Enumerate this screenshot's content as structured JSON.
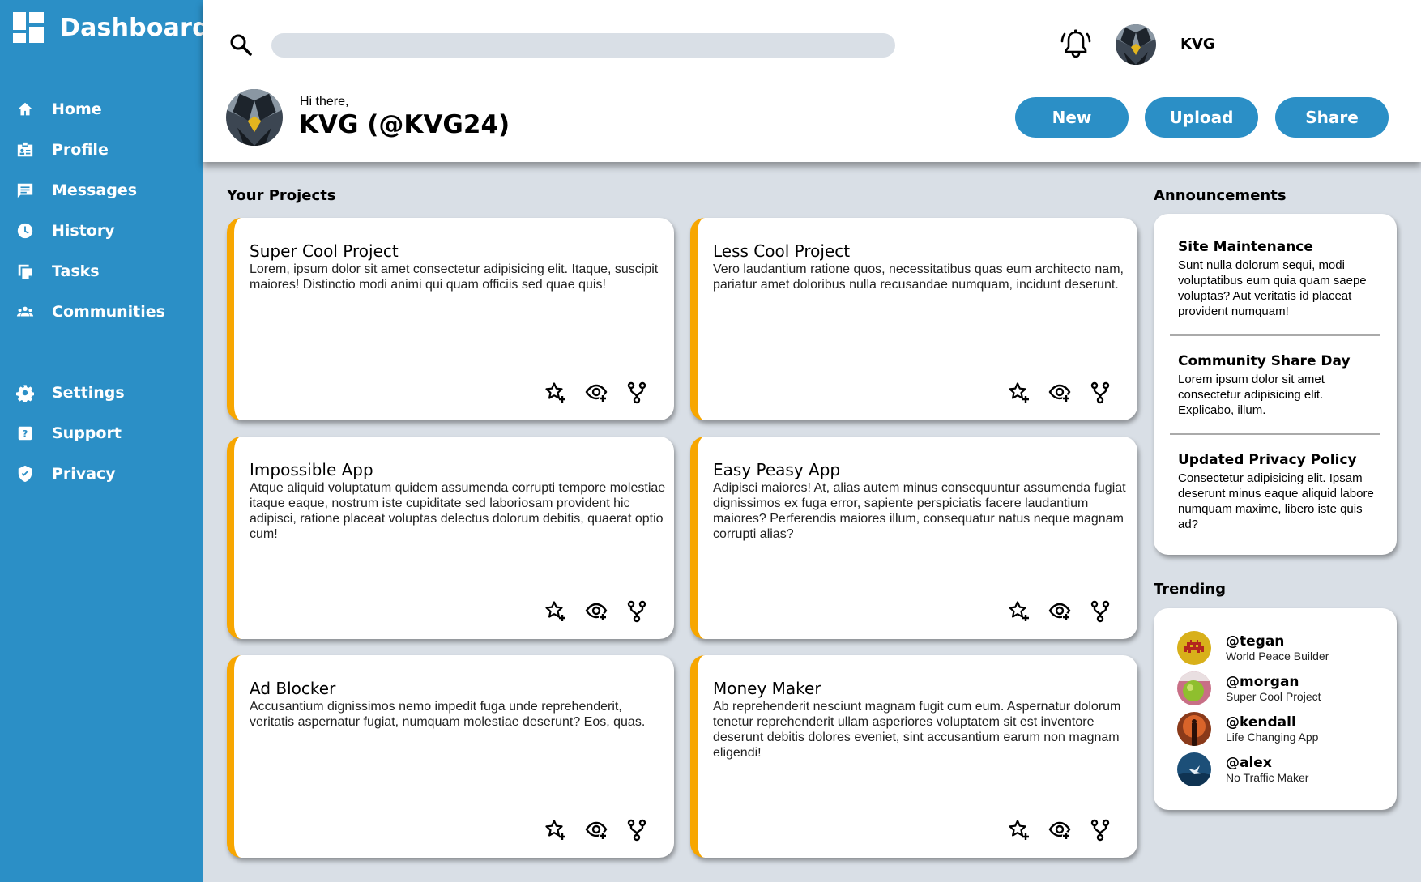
{
  "brand": {
    "title": "Dashboard"
  },
  "nav": {
    "items": [
      {
        "label": "Home",
        "icon": "home-icon"
      },
      {
        "label": "Profile",
        "icon": "id-card-icon"
      },
      {
        "label": "Messages",
        "icon": "message-icon"
      },
      {
        "label": "History",
        "icon": "clock-icon"
      },
      {
        "label": "Tasks",
        "icon": "tasks-icon"
      },
      {
        "label": "Communities",
        "icon": "people-icon"
      },
      {
        "label": "Settings",
        "icon": "gear-icon"
      },
      {
        "label": "Support",
        "icon": "help-icon"
      },
      {
        "label": "Privacy",
        "icon": "shield-icon"
      }
    ]
  },
  "header": {
    "search_placeholder": "",
    "user_short": "KVG",
    "greeting": "Hi there,",
    "display_name": "KVG (@KVG24)",
    "buttons": {
      "new": "New",
      "upload": "Upload",
      "share": "Share"
    }
  },
  "colors": {
    "accent": "#2b8fc6",
    "card_stripe": "#f7a600",
    "background": "#d9dfe6"
  },
  "projects": {
    "title": "Your Projects",
    "items": [
      {
        "title": "Super Cool Project",
        "description": "Lorem, ipsum dolor sit amet consectetur adipisicing elit. Itaque, suscipit maiores! Distinctio modi animi qui quam officiis sed quae quis!"
      },
      {
        "title": "Less Cool Project",
        "description": "Vero laudantium ratione quos, necessitatibus quas eum architecto nam, pariatur amet doloribus nulla recusandae numquam, incidunt deserunt."
      },
      {
        "title": "Impossible App",
        "description": "Atque aliquid voluptatum quidem assumenda corrupti tempore molestiae itaque eaque, nostrum iste cupiditate sed laboriosam provident hic adipisci, ratione placeat voluptas delectus dolorum debitis, quaerat optio cum!"
      },
      {
        "title": "Easy Peasy App",
        "description": "Adipisci maiores! At, alias autem minus consequuntur assumenda fugiat dignissimos ex fuga error, sapiente perspiciatis facere laudantium maiores? Perferendis maiores illum, consequatur natus neque magnam corrupti alias?"
      },
      {
        "title": "Ad Blocker",
        "description": "Accusantium dignissimos nemo impedit fuga unde reprehenderit, veritatis aspernatur fugiat, numquam molestiae deserunt? Eos, quas."
      },
      {
        "title": "Money Maker",
        "description": "Ab reprehenderit nesciunt magnam fugit cum eum. Aspernatur dolorum tenetur reprehenderit ullam asperiores voluptatem sit est inventore deserunt debitis dolores eveniet, sint accusantium earum non magnam eligendi!"
      }
    ]
  },
  "announcements": {
    "title": "Announcements",
    "items": [
      {
        "title": "Site Maintenance",
        "body": "Sunt nulla dolorum sequi, modi voluptatibus eum quia quam saepe voluptas? Aut veritatis id placeat provident numquam!"
      },
      {
        "title": "Community Share Day",
        "body": "Lorem ipsum dolor sit amet consectetur adipisicing elit. Explicabo, illum."
      },
      {
        "title": "Updated Privacy Policy",
        "body": "Consectetur adipisicing elit. Ipsam deserunt minus eaque aliquid labore numquam maxime, libero iste quis ad?"
      }
    ]
  },
  "trending": {
    "title": "Trending",
    "items": [
      {
        "handle": "@tegan",
        "project": "World Peace Builder"
      },
      {
        "handle": "@morgan",
        "project": "Super Cool Project"
      },
      {
        "handle": "@kendall",
        "project": "Life Changing App"
      },
      {
        "handle": "@alex",
        "project": "No Traffic Maker"
      }
    ]
  }
}
